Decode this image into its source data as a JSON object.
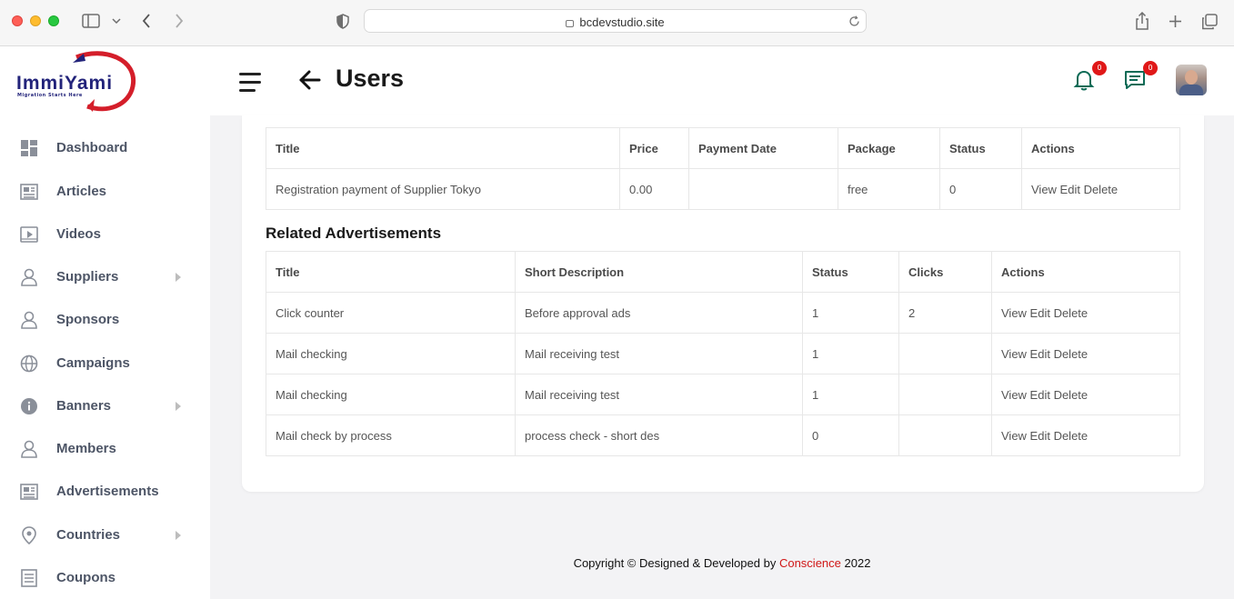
{
  "browser": {
    "url": "bcdevstudio.site"
  },
  "logo": {
    "name": "ImmiYami",
    "tagline": "Migration Starts Here"
  },
  "header": {
    "title": "Users",
    "notifications_count": "0",
    "messages_count": "0"
  },
  "sidebar": {
    "items": [
      {
        "label": "Dashboard",
        "icon": "dashboard-icon",
        "has_submenu": false
      },
      {
        "label": "Articles",
        "icon": "newspaper-icon",
        "has_submenu": false
      },
      {
        "label": "Videos",
        "icon": "video-icon",
        "has_submenu": false
      },
      {
        "label": "Suppliers",
        "icon": "users-icon",
        "has_submenu": true
      },
      {
        "label": "Sponsors",
        "icon": "users-icon",
        "has_submenu": false
      },
      {
        "label": "Campaigns",
        "icon": "globe-icon",
        "has_submenu": false
      },
      {
        "label": "Banners",
        "icon": "info-icon",
        "has_submenu": true
      },
      {
        "label": "Members",
        "icon": "users-icon",
        "has_submenu": false
      },
      {
        "label": "Advertisements",
        "icon": "newspaper-icon",
        "has_submenu": false
      },
      {
        "label": "Countries",
        "icon": "map-pin-icon",
        "has_submenu": true
      },
      {
        "label": "Coupons",
        "icon": "list-icon",
        "has_submenu": false
      }
    ]
  },
  "payments_table": {
    "columns": [
      "Title",
      "Price",
      "Payment Date",
      "Package",
      "Status",
      "Actions"
    ],
    "rows": [
      {
        "title": "Registration payment of Supplier Tokyo",
        "price": "0.00",
        "payment_date": "",
        "package": "free",
        "status": "0",
        "actions": "View Edit Delete"
      }
    ]
  },
  "ads_section": {
    "title": "Related Advertisements"
  },
  "ads_table": {
    "columns": [
      "Title",
      "Short Description",
      "Status",
      "Clicks",
      "Actions"
    ],
    "rows": [
      {
        "title": "Click counter",
        "short_description": "Before approval ads",
        "status": "1",
        "clicks": "2",
        "actions": "View Edit Delete"
      },
      {
        "title": "Mail checking",
        "short_description": "Mail receiving test",
        "status": "1",
        "clicks": "",
        "actions": "View Edit Delete"
      },
      {
        "title": "Mail checking",
        "short_description": "Mail receiving test",
        "status": "1",
        "clicks": "",
        "actions": "View Edit Delete"
      },
      {
        "title": "Mail check by process",
        "short_description": "process check - short des",
        "status": "0",
        "clicks": "",
        "actions": "View Edit Delete"
      }
    ]
  },
  "footer": {
    "prefix": "Copyright © Designed & Developed by",
    "brand": "Conscience",
    "year": "2022"
  }
}
